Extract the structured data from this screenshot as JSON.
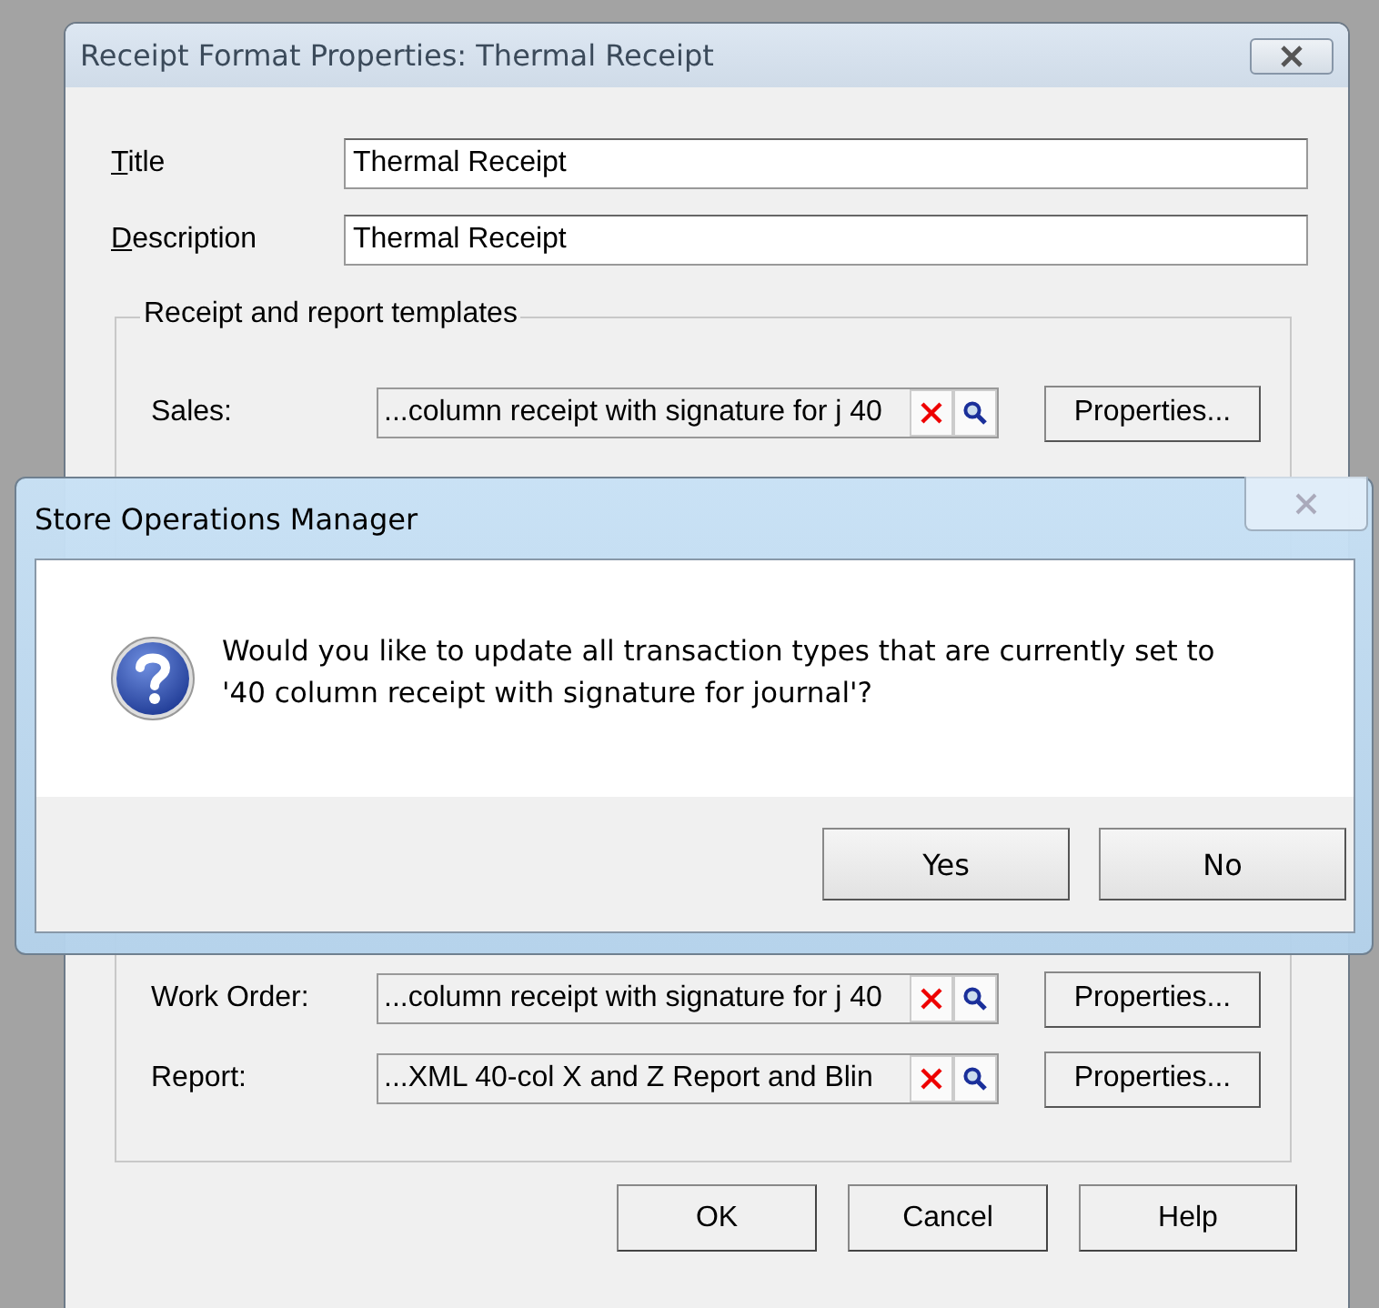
{
  "main_dialog": {
    "title": "Receipt Format Properties: Thermal Receipt",
    "fields": [
      {
        "label": "Title",
        "value": "Thermal Receipt"
      },
      {
        "label": "Description",
        "value": "Thermal Receipt"
      }
    ],
    "group": {
      "title": "Receipt and report templates",
      "top_rows": [
        {
          "label": "Sales:",
          "value": "...column receipt with signature for j 40",
          "button": "Properties..."
        }
      ],
      "bottom_rows": [
        {
          "label": "Work Order:",
          "value": "...column receipt with signature for j 40",
          "button": "Properties..."
        },
        {
          "label": "Report:",
          "value": "...XML 40-col X and Z Report and Blin",
          "button": "Properties..."
        }
      ]
    },
    "buttons": [
      "OK",
      "Cancel",
      "Help"
    ]
  },
  "message_box": {
    "title": "Store Operations Manager",
    "message_lines": [
      "Would you like to update all transaction types that are currently set to",
      "'40 column receipt with signature for journal'?"
    ],
    "buttons": [
      "Yes",
      "No"
    ]
  }
}
